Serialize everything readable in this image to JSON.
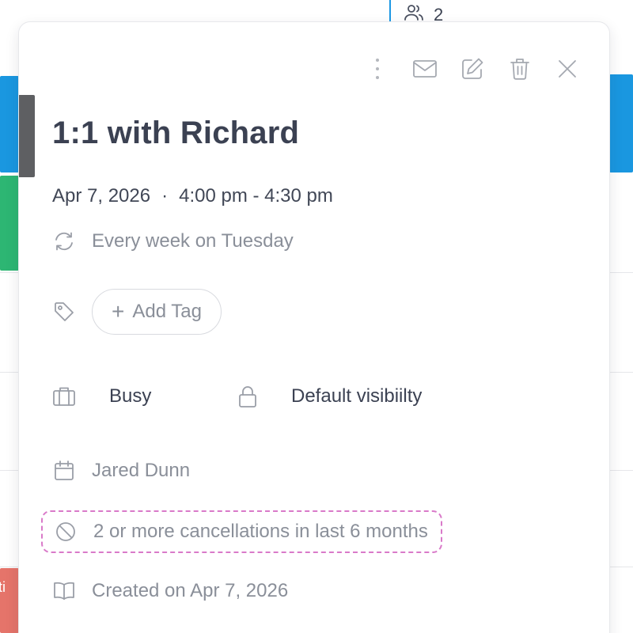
{
  "background": {
    "attendee_count": "2",
    "partial_event_text": "ti"
  },
  "toolbar": {
    "more_icon": "more-vertical-icon",
    "email_icon": "mail-icon",
    "edit_icon": "edit-icon",
    "delete_icon": "trash-icon",
    "close_icon": "close-icon"
  },
  "event": {
    "title": "1:1 with Richard",
    "date": "Apr 7, 2026",
    "separator": "·",
    "time_range": "4:00 pm - 4:30 pm",
    "recurrence": "Every week on Tuesday",
    "color": "#5e5f62"
  },
  "tags": {
    "add_label": "Add Tag"
  },
  "status": {
    "availability": "Busy",
    "visibility": "Default visibiilty"
  },
  "calendar": {
    "owner": "Jared Dunn"
  },
  "warning": {
    "text": "2 or more cancellations in last 6 months",
    "highlight_color": "#d97ac9"
  },
  "meta": {
    "created": "Created on Apr 7, 2026"
  }
}
